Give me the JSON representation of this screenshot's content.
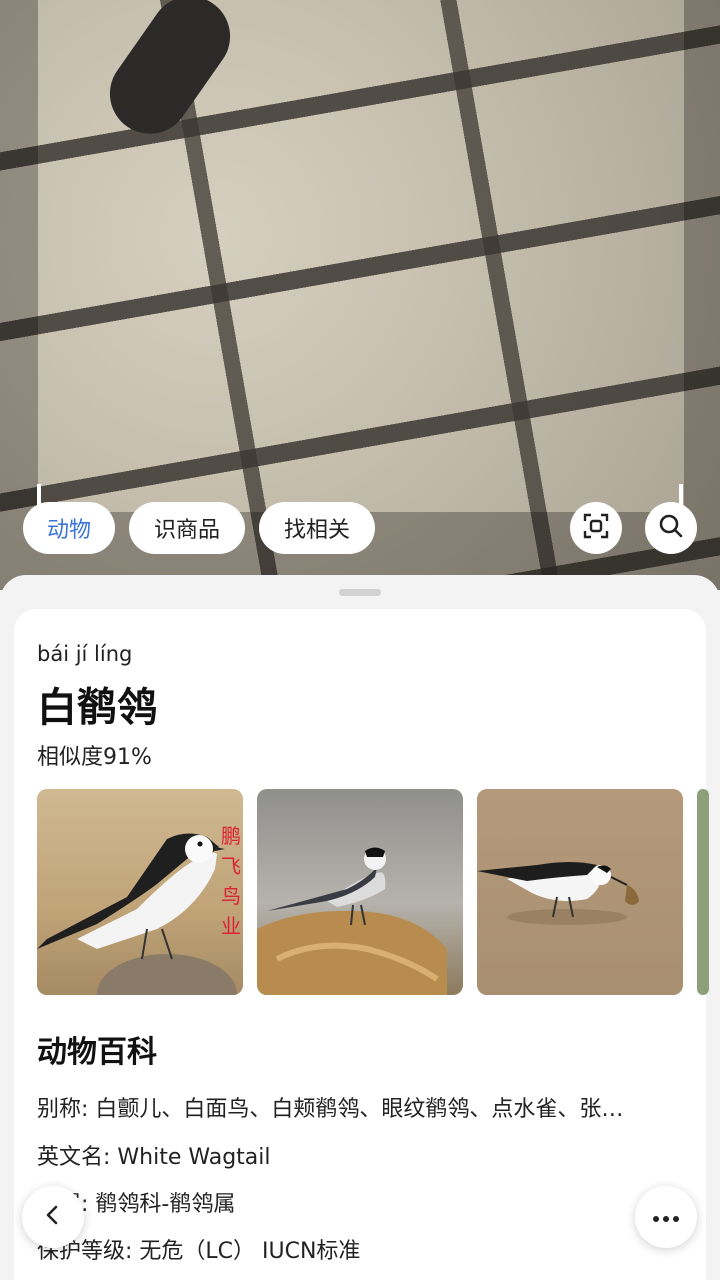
{
  "chips": {
    "animal": "动物",
    "product": "识商品",
    "related": "找相关"
  },
  "icons": {
    "scan": "scan-icon",
    "search": "search-icon",
    "back": "back-arrow-icon",
    "more": "more-dots-icon"
  },
  "result": {
    "pinyin": "bái jí líng",
    "name": "白鹡鸰",
    "similarity": "相似度91%",
    "watermark": "鹏飞鸟业"
  },
  "encyclopedia": {
    "title": "动物百科",
    "alias": "别称: 白颤儿、白面鸟、白颊鹡鸰、眼纹鹡鸰、点水雀、张…",
    "english_name": "英文名: White Wagtail",
    "family": "科属: 鹡鸰科-鹡鸰属",
    "protection": "保护等级: 无危（LC） IUCN标准"
  },
  "colors": {
    "accent": "#3b73d9",
    "watermark": "#d23"
  }
}
